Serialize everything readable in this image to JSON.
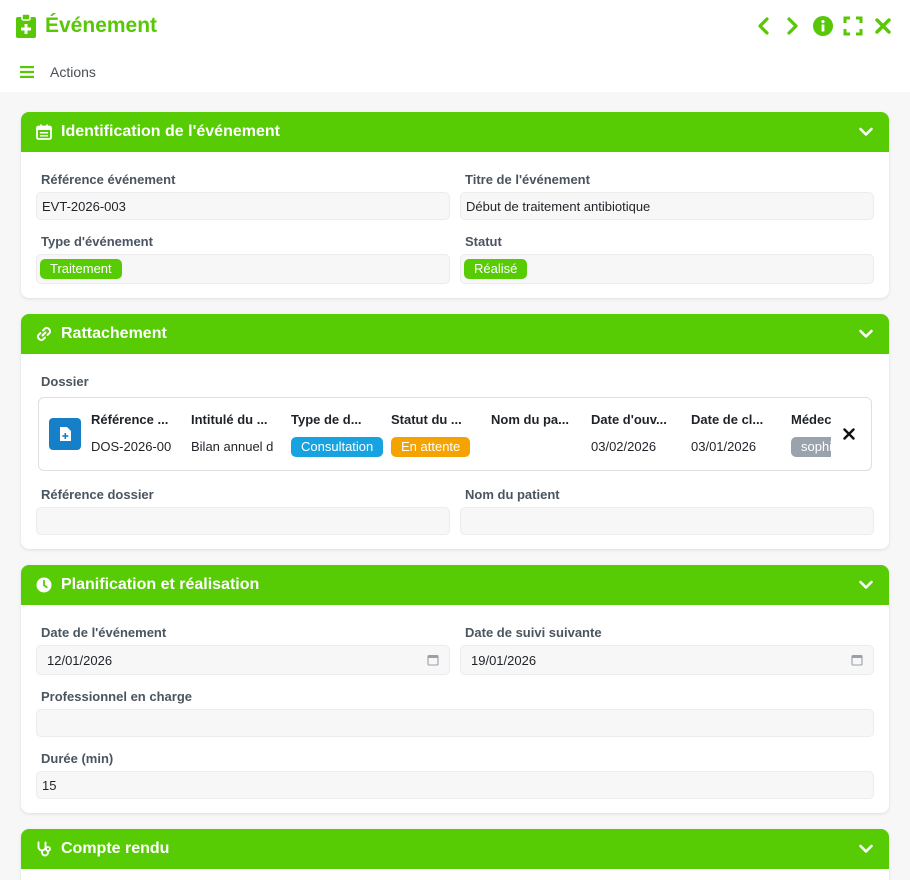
{
  "header": {
    "title": "Événement"
  },
  "toolbar": {
    "actions_label": "Actions"
  },
  "colors": {
    "accent": "#57cc04",
    "blue": "#16a3e0",
    "orange": "#f5a300",
    "grey": "#9aa3ad"
  },
  "identification": {
    "title": "Identification de l'événement",
    "ref_label": "Référence événement",
    "ref_value": "EVT-2026-003",
    "titre_label": "Titre de l'événement",
    "titre_value": "Début de traitement antibiotique",
    "type_label": "Type d'événement",
    "type_value": "Traitement",
    "statut_label": "Statut",
    "statut_value": "Réalisé"
  },
  "rattachement": {
    "title": "Rattachement",
    "dossier_label": "Dossier",
    "columns": [
      "Référence ...",
      "Intitulé du ...",
      "Type de d...",
      "Statut du ...",
      "Nom du pa...",
      "Date d'ouv...",
      "Date de cl...",
      "Médec"
    ],
    "row": {
      "reference": "DOS-2026-00",
      "intitule": "Bilan annuel d",
      "type": "Consultation",
      "statut": "En attente",
      "nom": "",
      "date_ouverture": "03/02/2026",
      "date_cloture": "03/01/2026",
      "medecin": "sophi"
    },
    "ref_dossier_label": "Référence dossier",
    "ref_dossier_value": "",
    "nom_patient_label": "Nom du patient",
    "nom_patient_value": ""
  },
  "planification": {
    "title": "Planification et réalisation",
    "date_label": "Date de l'événement",
    "date_value": "12/01/2026",
    "suivi_label": "Date de suivi suivante",
    "suivi_value": "19/01/2026",
    "pro_label": "Professionnel en charge",
    "pro_value": "",
    "duree_label": "Durée (min)",
    "duree_value": "15"
  },
  "compte_rendu": {
    "title": "Compte rendu"
  }
}
